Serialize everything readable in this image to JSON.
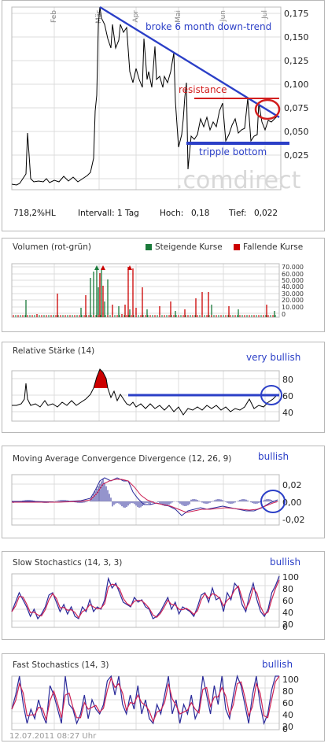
{
  "footer": "12.07.2011 08:27 Uhr",
  "colors": {
    "price": "#000000",
    "annotation_blue": "#2b3fc7",
    "annotation_red": "#d21e1e",
    "up": "#1a7a3a",
    "down": "#cc0000",
    "ma_blue": "#2a2a9a",
    "ma_red": "#cc2255"
  },
  "price": {
    "months": [
      "Feb",
      "Mär",
      "Apr",
      "Mai",
      "Jun",
      "Jul"
    ],
    "yticks": [
      "0,175",
      "0,150",
      "0,125",
      "0,100",
      "0,075",
      "0,050",
      "0,025"
    ],
    "watermark": ".comdirect",
    "annotations": {
      "downtrend": "broke 6 month down-trend",
      "resistance": "resistance",
      "bottom": "tripple bottom"
    },
    "stats": {
      "perf": "718,2%HL",
      "intervall": "Intervall: 1 Tag",
      "hoch_label": "Hoch:",
      "hoch": "0,18",
      "tief_label": "Tief:",
      "tief": "0,022"
    }
  },
  "volume": {
    "title": "Volumen (rot-grün)",
    "legend_up": "Steigende Kurse",
    "legend_down": "Fallende Kurse",
    "yticks": [
      "70.000",
      "60.000",
      "50.000",
      "40.000",
      "30.000",
      "20.000",
      "10.000",
      "0"
    ]
  },
  "rsi": {
    "title": "Relative Stärke (14)",
    "note": "very bullish",
    "yticks": [
      "80",
      "60",
      "40"
    ]
  },
  "macd": {
    "title": "Moving Average Convergence Divergence (12, 26, 9)",
    "note": "bullish",
    "yticks": [
      "0,02",
      "0,00",
      "-0,02"
    ]
  },
  "slow": {
    "title": "Slow Stochastics (14, 3, 3)",
    "note": "bullish",
    "yticks": [
      "100",
      "80",
      "60",
      "40",
      "20",
      "0"
    ]
  },
  "fast": {
    "title": "Fast Stochastics (14, 3)",
    "note": "bullish",
    "yticks": [
      "100",
      "80",
      "60",
      "40",
      "20",
      "0"
    ]
  },
  "chart_data": [
    {
      "type": "line",
      "title": "",
      "x": [
        "Feb",
        "Mär",
        "Apr",
        "Mai",
        "Jun",
        "Jul"
      ],
      "series": [
        {
          "values": [
            0.022,
            0.03,
            0.18,
            0.16,
            0.14,
            0.07,
            0.08,
            0.085
          ]
        }
      ],
      "ylim": [
        0.015,
        0.18
      ]
    },
    {
      "type": "bar",
      "title": "Volumen (rot-grün)",
      "series": [
        {
          "name": "Steigende Kurse"
        },
        {
          "name": "Fallende Kurse"
        }
      ],
      "ylim": [
        0,
        70000
      ]
    },
    {
      "type": "line",
      "title": "Relative Stärke (14)",
      "ylim": [
        30,
        90
      ]
    },
    {
      "type": "line",
      "title": "Moving Average Convergence Divergence (12, 26, 9)",
      "ylim": [
        -0.025,
        0.03
      ]
    },
    {
      "type": "line",
      "title": "Slow Stochastics (14, 3, 3)",
      "ylim": [
        0,
        100
      ]
    },
    {
      "type": "line",
      "title": "Fast Stochastics (14, 3)",
      "ylim": [
        0,
        100
      ]
    }
  ]
}
